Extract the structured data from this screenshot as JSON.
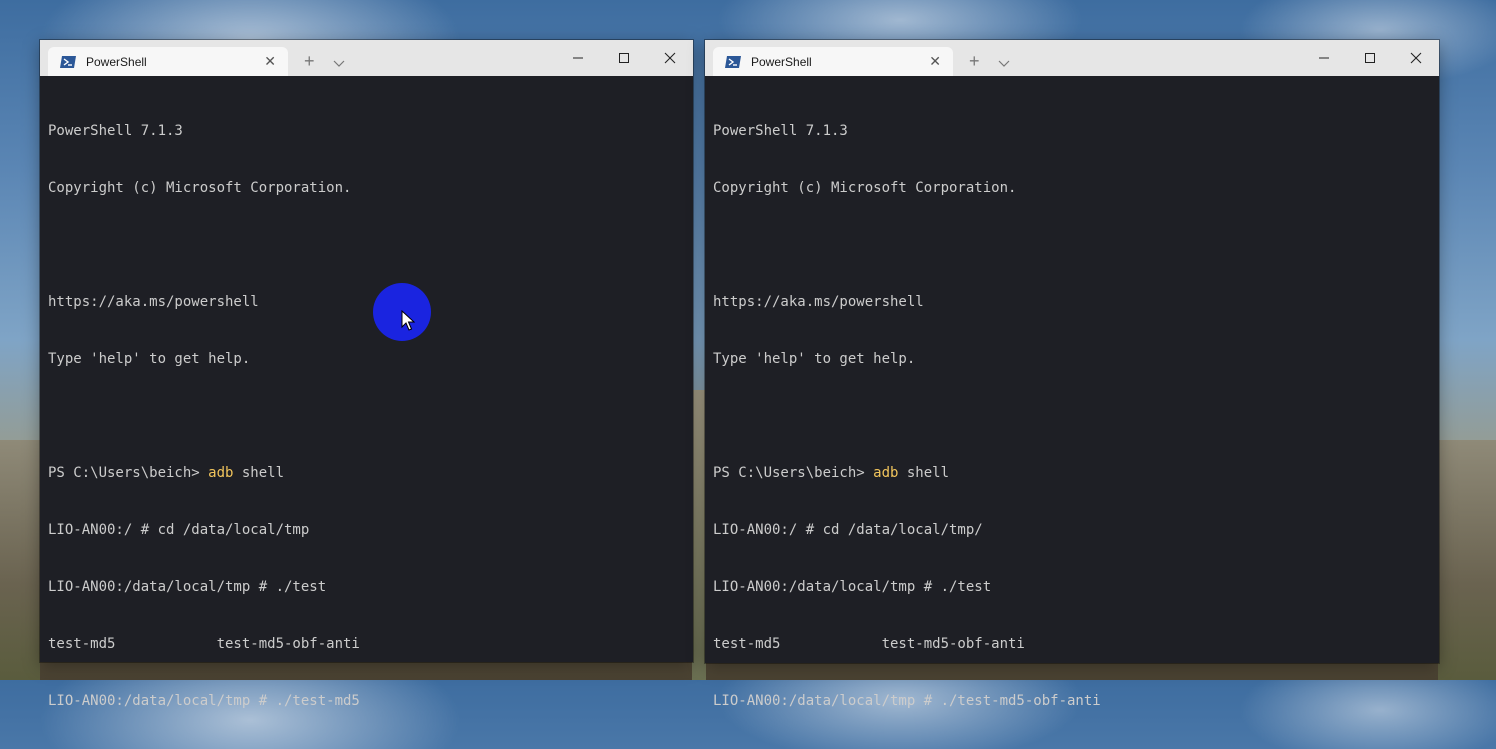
{
  "left_window": {
    "tab_title": "PowerShell",
    "lines": [
      "PowerShell 7.1.3",
      "Copyright (c) Microsoft Corporation.",
      "",
      "https://aka.ms/powershell",
      "Type 'help' to get help.",
      ""
    ],
    "prompt_prefix": "PS C:\\Users\\beich> ",
    "prompt_cmd": "adb",
    "prompt_args": " shell",
    "lines_after": [
      "LIO-AN00:/ # cd /data/local/tmp",
      "LIO-AN00:/data/local/tmp # ./test",
      "test-md5            test-md5-obf-anti",
      "LIO-AN00:/data/local/tmp # ./test-md5"
    ]
  },
  "right_window": {
    "tab_title": "PowerShell",
    "lines": [
      "PowerShell 7.1.3",
      "Copyright (c) Microsoft Corporation.",
      "",
      "https://aka.ms/powershell",
      "Type 'help' to get help.",
      ""
    ],
    "prompt_prefix": "PS C:\\Users\\beich> ",
    "prompt_cmd": "adb",
    "prompt_args": " shell",
    "lines_after": [
      "LIO-AN00:/ # cd /data/local/tmp/",
      "LIO-AN00:/data/local/tmp # ./test",
      "test-md5            test-md5-obf-anti",
      "LIO-AN00:/data/local/tmp # ./test-md5-obf-anti"
    ]
  },
  "controls": {
    "new_tab": "+",
    "tab_close": "✕"
  },
  "colors": {
    "terminal_bg": "#1e1f25",
    "terminal_fg": "#cccccc",
    "command_highlight": "#f2c55c",
    "click_indicator": "#1a24e0"
  },
  "icons": {
    "tab": "powershell-icon",
    "new_tab": "plus-icon",
    "dropdown": "chevron-down-icon",
    "minimize": "minimize-icon",
    "maximize": "maximize-icon",
    "close": "close-icon"
  }
}
